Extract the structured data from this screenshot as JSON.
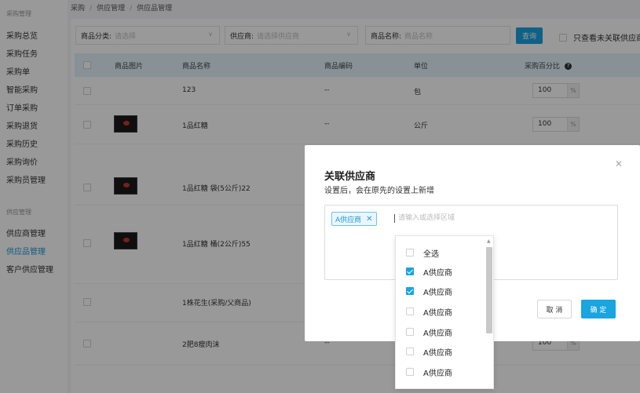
{
  "sidebar": {
    "group1": "采购管理",
    "items1": [
      "采购总览",
      "采购任务",
      "采购单",
      "智能采购",
      "订单采购",
      "采购退货",
      "采购历史",
      "采购询价",
      "采购员管理"
    ],
    "group2": "供应管理",
    "items2": [
      "供应商管理",
      "供应品管理",
      "客户供应管理"
    ]
  },
  "breadcrumb": [
    "采购",
    "供应管理",
    "供应品管理"
  ],
  "filters": {
    "category_label": "商品分类:",
    "category_placeholder": "请选择",
    "supplier_label": "供应商:",
    "supplier_placeholder": "请选择供应商",
    "name_label": "商品名称:",
    "name_placeholder": "商品名称",
    "query_button": "查询",
    "only_unlinked_label": "只查看未关联供应商"
  },
  "table": {
    "headers": [
      "商品图片",
      "商品名称",
      "商品编码",
      "单位",
      "采购百分比"
    ],
    "rows": [
      {
        "name": "123",
        "code": "--",
        "unit": "包",
        "pct": "100",
        "has_image": false
      },
      {
        "name": "1品红糖",
        "code": "--",
        "unit": "公斤",
        "pct": "100",
        "has_image": true
      },
      {
        "name": "1品红糖 袋(5公斤)22",
        "code": "",
        "unit": "",
        "pct": "",
        "has_image": true
      },
      {
        "name": "1品红糖 桶(2公斤)55",
        "code": "",
        "unit": "",
        "pct": "",
        "has_image": true
      },
      {
        "name": "1株花生(采购/父商品)",
        "code": "",
        "unit": "",
        "pct": "",
        "has_image": false
      },
      {
        "name": "2肥8瘦肉沫",
        "code": "--",
        "unit": "",
        "pct": "100",
        "has_image": false
      }
    ],
    "pct_unit": "%"
  },
  "modal": {
    "title": "关联供应商",
    "subtitle": "设置后，会在原先的设置上新增",
    "tag_label": "A供应商",
    "input_placeholder": "请输入或选择区域",
    "cancel_button": "取 消",
    "ok_button": "确 定",
    "close_icon": "close-icon"
  },
  "dropdown": {
    "select_all": "全选",
    "options": [
      {
        "label": "A供应商",
        "checked": true
      },
      {
        "label": "A供应商",
        "checked": true
      },
      {
        "label": "A供应商",
        "checked": false
      },
      {
        "label": "A供应商",
        "checked": false
      },
      {
        "label": "A供应商",
        "checked": false
      },
      {
        "label": "A供应商",
        "checked": false
      }
    ]
  },
  "colors": {
    "accent": "#1aa4e0",
    "header_bg": "#e2f2fa"
  }
}
